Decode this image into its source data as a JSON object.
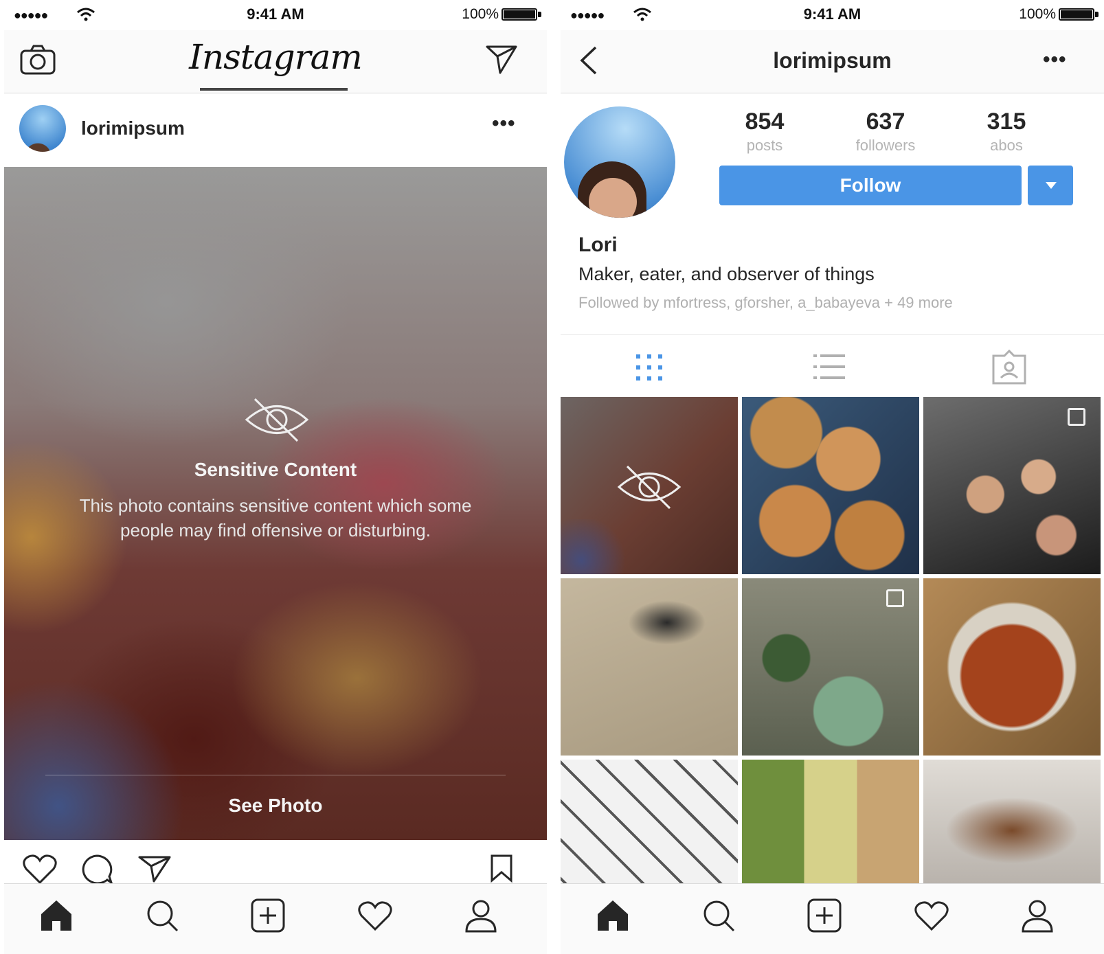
{
  "left_screen": {
    "status_bar": {
      "signal": "●●●●●",
      "time": "9:41 AM",
      "battery": "100%"
    },
    "header": {
      "logo": "Instagram",
      "camera_icon": "camera-icon",
      "direct_icon": "paper-plane-icon"
    },
    "post": {
      "username": "lorimipsum",
      "more": "•••",
      "overlay_icon": "eye-slash-icon",
      "overlay_title": "Sensitive Content",
      "overlay_description": "This photo contains sensitive content which some people may find offensive or disturbing.",
      "see_photo_label": "See Photo"
    },
    "actions": [
      "heart-icon",
      "comment-icon",
      "share-icon",
      "bookmark-icon"
    ],
    "tab_bar": [
      "home-icon",
      "search-icon",
      "add-icon",
      "activity-icon",
      "profile-icon"
    ]
  },
  "right_screen": {
    "status_bar": {
      "signal": "●●●●●",
      "time": "9:41 AM",
      "battery": "100%"
    },
    "header": {
      "title": "lorimipsum",
      "more": "•••",
      "back_icon": "chevron-left-icon"
    },
    "profile": {
      "stats": [
        {
          "value": "854",
          "label": "posts"
        },
        {
          "value": "637",
          "label": "followers"
        },
        {
          "value": "315",
          "label": "abos"
        }
      ],
      "follow_label": "Follow",
      "name": "Lori",
      "bio": "Maker, eater, and observer of things",
      "followed_by": "Followed by mfortress, gforsher, a_babayeva + 49 more"
    },
    "view_tabs": [
      "grid-icon",
      "list-icon",
      "tagged-icon"
    ],
    "tab_bar": [
      "home-icon",
      "search-icon",
      "add-icon",
      "activity-icon",
      "profile-icon"
    ]
  },
  "colors": {
    "accent": "#4a95e6",
    "text": "#262626",
    "muted": "#b0b0b0",
    "divider": "#dbdbdb"
  }
}
